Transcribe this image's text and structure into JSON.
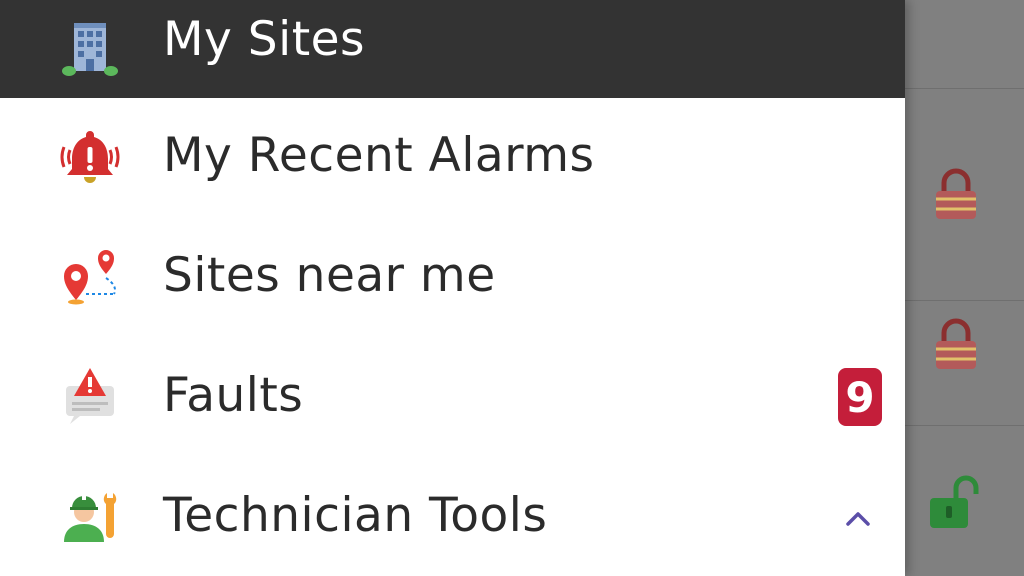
{
  "drawer": {
    "items": [
      {
        "label": "My Sites",
        "icon": "office-building-icon",
        "selected": true
      },
      {
        "label": "My Recent Alarms",
        "icon": "alarm-bell-icon"
      },
      {
        "label": "Sites near me",
        "icon": "map-pins-route-icon"
      },
      {
        "label": "Faults",
        "icon": "warning-message-icon",
        "badge": "9"
      },
      {
        "label": "Technician Tools",
        "icon": "technician-icon",
        "expand": "chevron-up-icon"
      }
    ]
  },
  "colors": {
    "header_bg": "#333333",
    "badge_bg": "#c41e3a",
    "chevron": "#5b4ea8",
    "lock_open": "#2e8b3a",
    "lock_closed": "#8b2f2f"
  }
}
